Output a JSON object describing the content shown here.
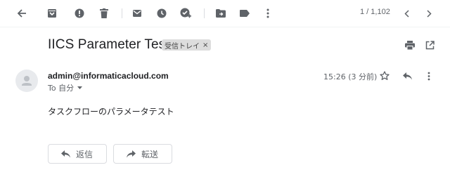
{
  "toolbar": {
    "icons": [
      "back-arrow-icon",
      "archive-icon",
      "report-spam-icon",
      "delete-icon",
      "mark-unread-icon",
      "snooze-icon",
      "add-to-tasks-icon",
      "move-to-icon",
      "labels-icon",
      "more-vert-icon"
    ]
  },
  "pager": {
    "text": "1 / 1,102"
  },
  "message": {
    "subject": "IICS Parameter Test",
    "label": "受信トレイ",
    "label_close": "×",
    "sender": "admin@informaticacloud.com",
    "to": "To 自分",
    "time": "15:26 (3 分前)",
    "body": "タスクフローのパラメータテスト"
  },
  "actions": {
    "reply": "返信",
    "forward": "転送"
  },
  "colors": {
    "icon": "#5f6368",
    "divider": "#dadce0",
    "chip": "#dddddd"
  }
}
